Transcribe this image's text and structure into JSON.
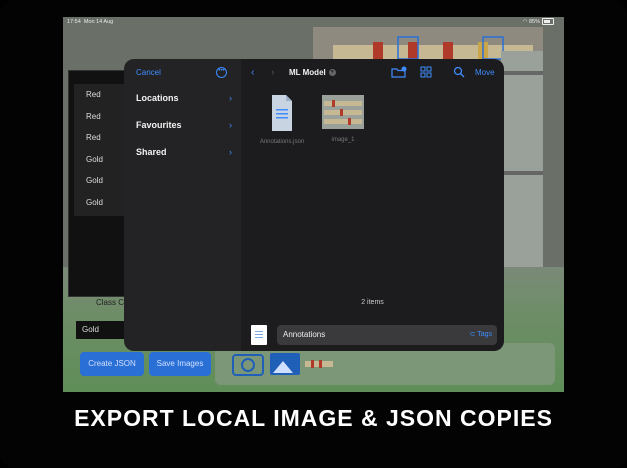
{
  "status": {
    "time": "17:54",
    "date": "Mon 14 Aug",
    "battery": "85%"
  },
  "bg_app": {
    "colors": [
      "Red",
      "Red",
      "Red",
      "Gold",
      "Gold",
      "Gold"
    ],
    "class_label": "Class C",
    "class_value": "Gold",
    "create_json": "Create JSON",
    "save_images": "Save Images"
  },
  "dialog": {
    "cancel": "Cancel",
    "sidebar": [
      "Locations",
      "Favourites",
      "Shared"
    ],
    "folder_title": "ML Model",
    "move": "Move",
    "files": [
      {
        "name": "Annotations.json",
        "meta1": "",
        "meta2": ""
      },
      {
        "name": "image_1",
        "meta1": "",
        "meta2": ""
      }
    ],
    "item_count": "2 items",
    "filename": "Annotations",
    "tags": "Tags"
  },
  "caption": "EXPORT LOCAL IMAGE & JSON COPIES"
}
